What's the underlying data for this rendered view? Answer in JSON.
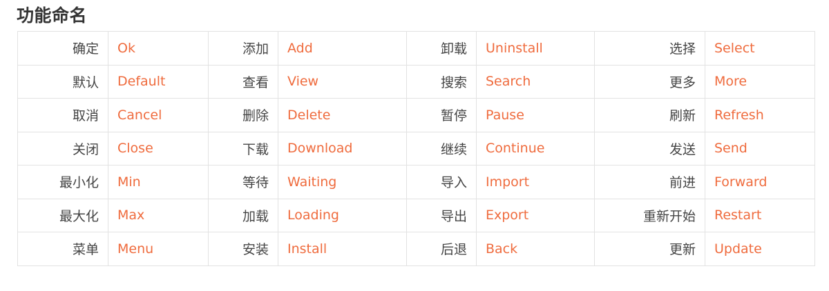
{
  "page": {
    "title": "功能命名"
  },
  "table": {
    "rows": [
      [
        {
          "zh": "确定",
          "en": "Ok"
        },
        {
          "zh": "添加",
          "en": "Add"
        },
        {
          "zh": "卸载",
          "en": "Uninstall"
        },
        {
          "zh": "选择",
          "en": "Select"
        }
      ],
      [
        {
          "zh": "默认",
          "en": "Default"
        },
        {
          "zh": "查看",
          "en": "View"
        },
        {
          "zh": "搜索",
          "en": "Search"
        },
        {
          "zh": "更多",
          "en": "More"
        }
      ],
      [
        {
          "zh": "取消",
          "en": "Cancel"
        },
        {
          "zh": "删除",
          "en": "Delete"
        },
        {
          "zh": "暂停",
          "en": "Pause"
        },
        {
          "zh": "刷新",
          "en": "Refresh"
        }
      ],
      [
        {
          "zh": "关闭",
          "en": "Close"
        },
        {
          "zh": "下载",
          "en": "Download"
        },
        {
          "zh": "继续",
          "en": "Continue"
        },
        {
          "zh": "发送",
          "en": "Send"
        }
      ],
      [
        {
          "zh": "最小化",
          "en": "Min"
        },
        {
          "zh": "等待",
          "en": "Waiting"
        },
        {
          "zh": "导入",
          "en": "Import"
        },
        {
          "zh": "前进",
          "en": "Forward"
        }
      ],
      [
        {
          "zh": "最大化",
          "en": "Max"
        },
        {
          "zh": "加载",
          "en": "Loading"
        },
        {
          "zh": "导出",
          "en": "Export"
        },
        {
          "zh": "重新开始",
          "en": "Restart"
        }
      ],
      [
        {
          "zh": "菜单",
          "en": "Menu"
        },
        {
          "zh": "安装",
          "en": "Install"
        },
        {
          "zh": "后退",
          "en": "Back"
        },
        {
          "zh": "更新",
          "en": "Update"
        }
      ]
    ]
  },
  "colors": {
    "title": "#333333",
    "chinese_text": "#444444",
    "english_text": "#ef6b3d",
    "border": "#e2e2e2"
  }
}
